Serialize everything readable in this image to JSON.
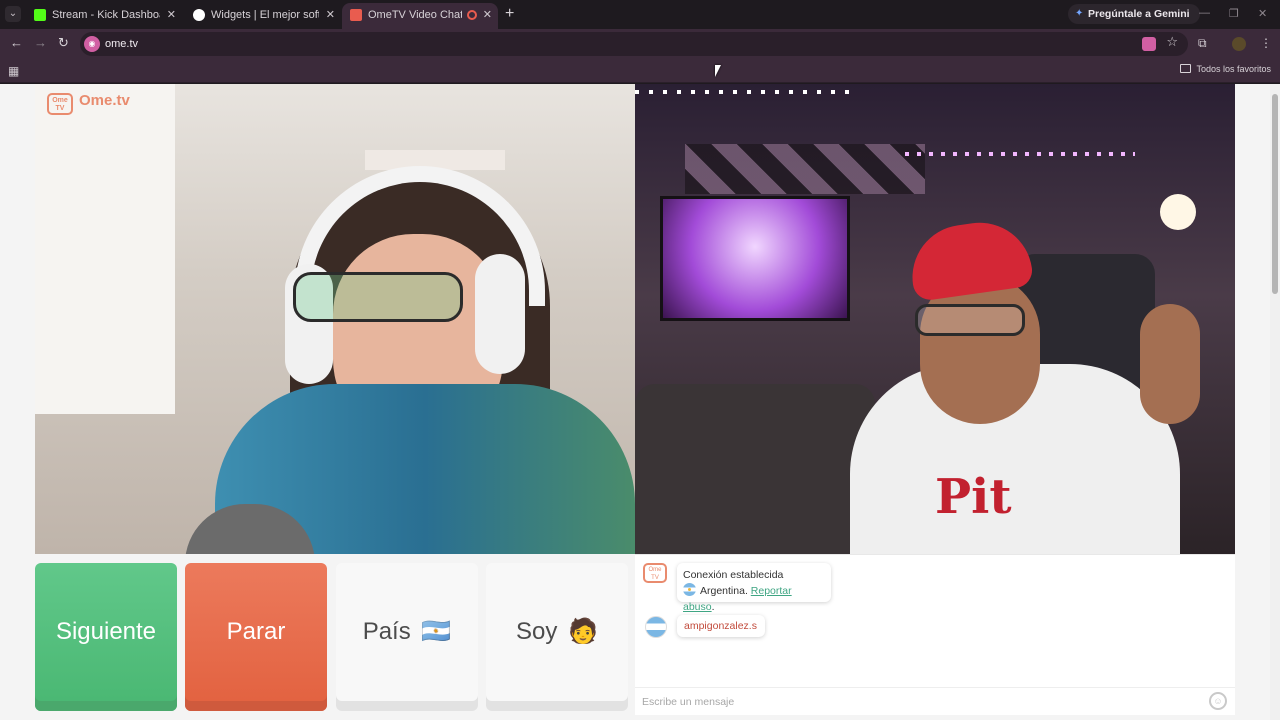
{
  "browser": {
    "tabs": [
      {
        "title": "Stream - Kick Dashboard",
        "favicon_color": "#53fc18"
      },
      {
        "title": "Widgets | El mejor software par",
        "favicon_color": "#ffffff"
      },
      {
        "title": "OmeTV Video Chat — Ome",
        "favicon_color": "#e95c4f"
      }
    ],
    "gemini_label": "Pregúntale a Gemini",
    "url": "ome.tv",
    "all_favorites": "Todos los favoritos"
  },
  "ome": {
    "logo_text": "Ome.tv",
    "logo_badge": "Ome TV"
  },
  "controls": {
    "next_label": "Siguiente",
    "stop_label": "Parar",
    "country_label": "País",
    "country_flag": "🇦🇷",
    "gender_label": "Soy",
    "gender_emoji": "🧑"
  },
  "shirt_print": "Pit",
  "chat": {
    "system_line1": "Conexión establecida",
    "country_name": "Argentina.",
    "report_link": "Reportar abuso",
    "report_suffix": ".",
    "username": "ampigonzalez.s",
    "input_placeholder": "Escribe un mensaje"
  },
  "colors": {
    "next_green": "#49b772",
    "stop_red": "#e2613f",
    "brand_orange": "#e98b6e",
    "link_green": "#3fa583"
  }
}
